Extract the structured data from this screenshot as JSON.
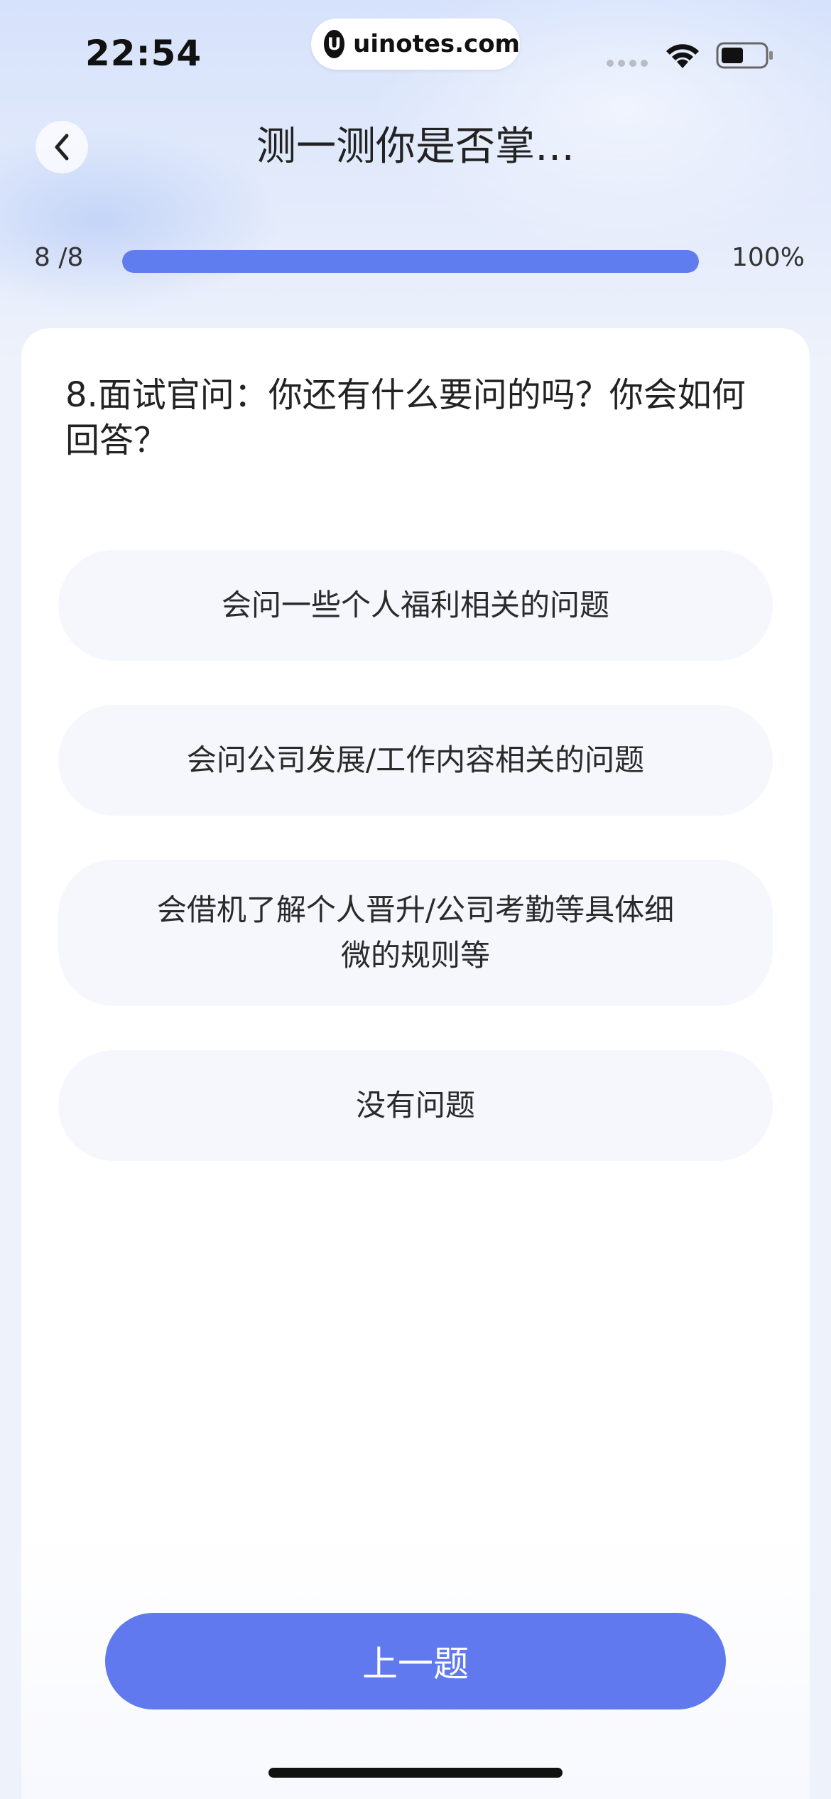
{
  "status_bar": {
    "time": "22:54",
    "watermark": "uinotes.com",
    "watermark_logo": "U"
  },
  "header": {
    "title": "测一测你是否掌…"
  },
  "progress": {
    "count": "8 /8",
    "percent_label": "100%",
    "fraction": 1.0
  },
  "question": {
    "text": "8.面试官问：你还有什么要问的吗？你会如何回答？"
  },
  "options": [
    {
      "label": "会问一些个人福利相关的问题"
    },
    {
      "label": "会问公司发展/工作内容相关的问题"
    },
    {
      "label": "会借机了解个人晋升/公司考勤等具体细微的规则等"
    },
    {
      "label": "没有问题"
    }
  ],
  "footer": {
    "prev_label": "上一题"
  },
  "colors": {
    "accent": "#6079ee",
    "option_bg": "#f5f7fd",
    "progress_track": "#dfe5f7"
  }
}
